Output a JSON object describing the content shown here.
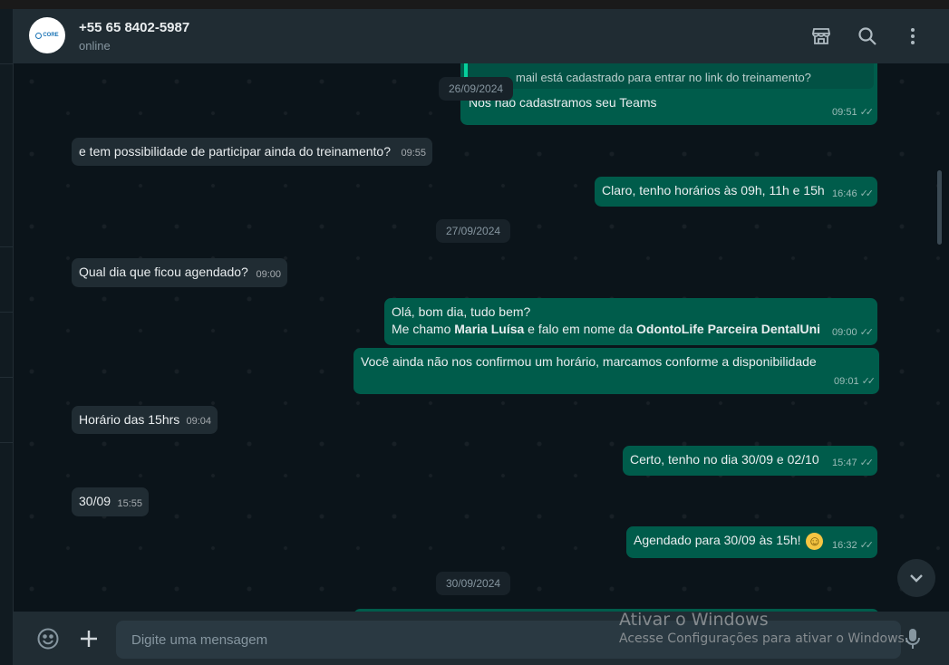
{
  "header": {
    "contact_name": "+55 65 8402-5987",
    "status": "online",
    "avatar_text": "CORE",
    "icons": [
      "catalog-icon",
      "search-icon",
      "menu-icon"
    ]
  },
  "quoted": {
    "text": "mail está cadastrado para entrar no link do treinamento?"
  },
  "messages": [
    {
      "dir": "out",
      "text": "Nós não cadastramos seu Teams",
      "time": "09:51"
    },
    {
      "dir": "in",
      "text": "e tem possibilidade de participar ainda do treinamento?",
      "time": "09:55"
    },
    {
      "dir": "out",
      "text": "Claro, tenho horários às 09h, 11h e 15h",
      "time": "16:46"
    },
    {
      "dir": "in",
      "text": "Qual dia que ficou agendado?",
      "time": "09:00"
    },
    {
      "dir": "out",
      "line1": "Olá, bom dia, tudo bem?",
      "line2_prefix": "Me chamo ",
      "line2_name": "Maria Luísa",
      "line2_mid": " e falo em nome da ",
      "line2_company": "OdontoLife Parceira DentalUni",
      "time": "09:00"
    },
    {
      "dir": "out",
      "text": "Você ainda não nos confirmou um horário, marcamos conforme a disponibilidade",
      "time": "09:01"
    },
    {
      "dir": "in",
      "text": "Horário das 15hrs",
      "time": "09:04"
    },
    {
      "dir": "out",
      "text": "Certo, tenho no dia 30/09 e 02/10",
      "time": "15:47"
    },
    {
      "dir": "in",
      "text": "30/09",
      "time": "15:55"
    },
    {
      "dir": "out",
      "text": "Agendado para 30/09 às 15h!",
      "emoji": "☺",
      "time": "16:32"
    }
  ],
  "dates": [
    "26/09/2024",
    "27/09/2024",
    "30/09/2024"
  ],
  "footer": {
    "placeholder": "Digite uma mensagem"
  },
  "watermark": {
    "line1": "Ativar o Windows",
    "line2": "Acesse Configurações para ativar o Windows."
  },
  "colors": {
    "incoming": "#202c33",
    "outgoing": "#005c4b",
    "background": "#0b141a",
    "accent": "#06cf9c"
  }
}
